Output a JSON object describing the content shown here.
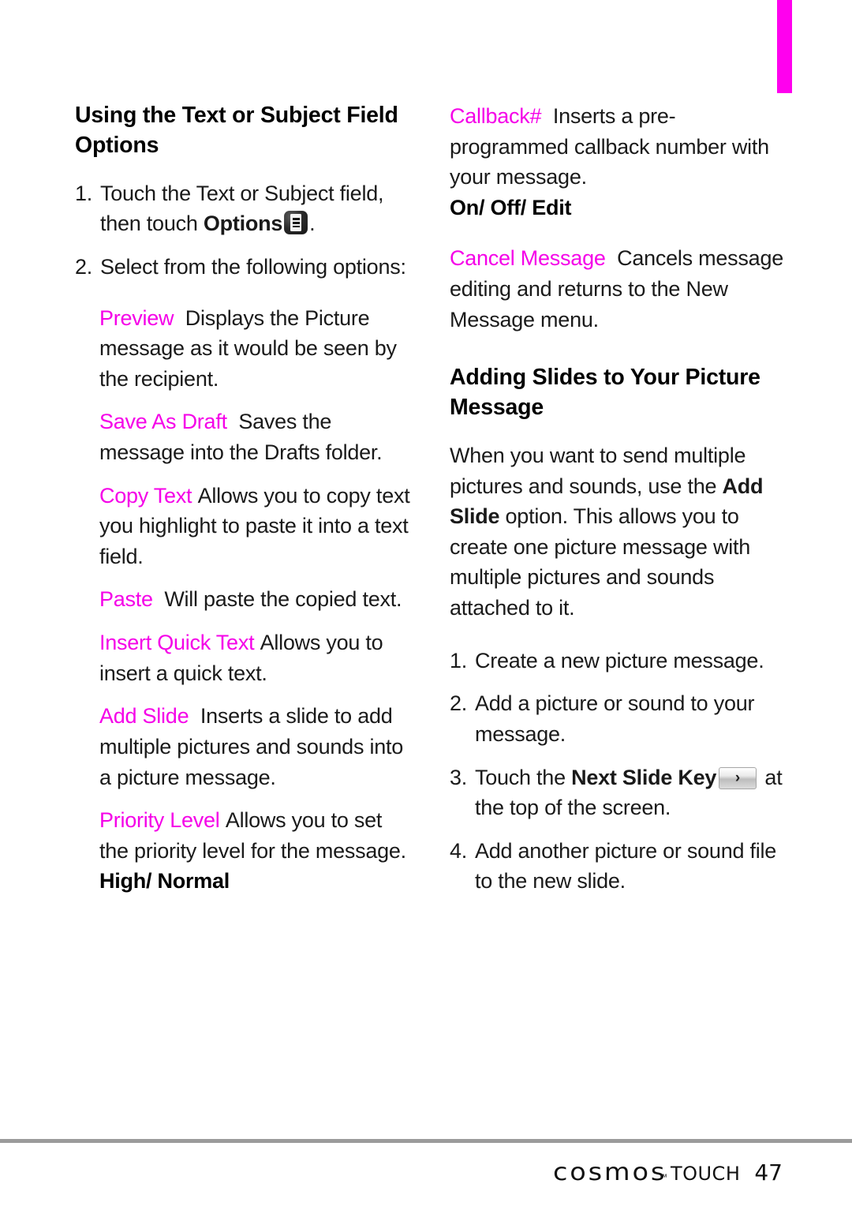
{
  "document": {
    "type": "phone-user-manual-page",
    "accent_color": "#f500e8",
    "edge_tab_color": "#ff00ee"
  },
  "left_column": {
    "heading": "Using the Text or Subject Field Options",
    "steps": [
      {
        "num": "1.",
        "text_before": "Touch the Text or Subject field, then touch ",
        "bold": "Options",
        "icon": "options-list-icon",
        "text_after": "."
      },
      {
        "num": "2.",
        "text_before": "Select from the following options:",
        "bold": "",
        "icon": "",
        "text_after": ""
      }
    ],
    "options": [
      {
        "keyword": "Preview",
        "description": "Displays the Picture message as it would be seen by the recipient."
      },
      {
        "keyword": "Save As Draft",
        "description": "Saves the message into the Drafts folder."
      },
      {
        "keyword": "Copy Text",
        "description": "Allows you to copy text you highlight to paste it into a text field."
      },
      {
        "keyword": "Paste",
        "description": "Will paste the copied text."
      },
      {
        "keyword": "Insert Quick Text",
        "description": "Allows you to insert a quick text."
      },
      {
        "keyword": "Add Slide",
        "description": "Inserts a slide to add multiple pictures and sounds into a picture message."
      },
      {
        "keyword": "Priority Level",
        "description": "Allows you to set the priority level for the message.",
        "values": "High/ Normal"
      }
    ]
  },
  "right_column": {
    "options": [
      {
        "keyword": "Callback#",
        "description": "Inserts a pre-programmed callback number with your message.",
        "values": "On/ Off/ Edit"
      },
      {
        "keyword": "Cancel Message",
        "description": "Cancels message editing and returns to the New Message menu."
      }
    ],
    "heading": "Adding Slides to Your Picture Message",
    "paragraph": {
      "part1": "When you want to send multiple pictures and sounds, use the ",
      "bold1": "Add Slide",
      "part2": " option. This allows you to create one picture message with multiple pictures and sounds attached to it."
    },
    "steps": [
      {
        "num": "1.",
        "text_before": "Create a new picture message.",
        "bold": "",
        "icon": "",
        "text_after": ""
      },
      {
        "num": "2.",
        "text_before": "Add a picture or sound to your message.",
        "bold": "",
        "icon": "",
        "text_after": ""
      },
      {
        "num": "3.",
        "text_before": "Touch the ",
        "bold": "Next Slide Key",
        "icon": "next-slide-chevron-icon",
        "text_after": " at the top of the screen."
      },
      {
        "num": "4.",
        "text_before": "Add another picture or sound file to the new slide.",
        "bold": "",
        "icon": "",
        "text_after": ""
      }
    ]
  },
  "footer": {
    "brand": "cosmos",
    "trademark": "™",
    "product": "TOUCH",
    "page_number": "47"
  }
}
